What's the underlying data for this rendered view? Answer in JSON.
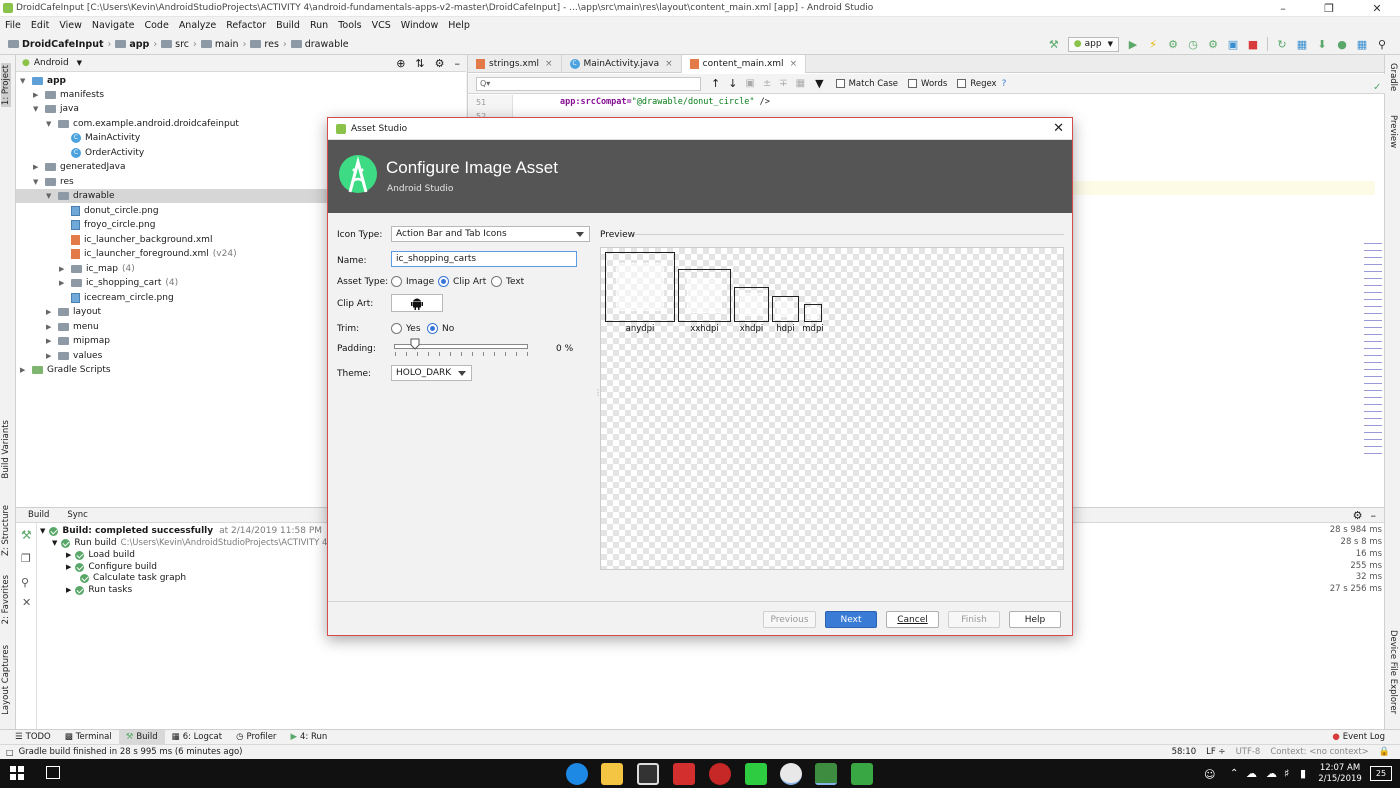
{
  "window": {
    "title": "DroidCafeInput [C:\\Users\\Kevin\\AndroidStudioProjects\\ACTIVITY 4\\android-fundamentals-apps-v2-master\\DroidCafeInput] - ...\\app\\src\\main\\res\\layout\\content_main.xml [app] - Android Studio"
  },
  "menu": [
    "File",
    "Edit",
    "View",
    "Navigate",
    "Code",
    "Analyze",
    "Refactor",
    "Build",
    "Run",
    "Tools",
    "VCS",
    "Window",
    "Help"
  ],
  "breadcrumbs": [
    "DroidCafeInput",
    "app",
    "src",
    "main",
    "res",
    "drawable"
  ],
  "toolbar": {
    "run_config": "app"
  },
  "project": {
    "view_mode": "Android",
    "tree": {
      "app": "app",
      "manifests": "manifests",
      "java": "java",
      "package": "com.example.android.droidcafeinput",
      "main_activity": "MainActivity",
      "order_activity": "OrderActivity",
      "generated_java": "generatedJava",
      "res": "res",
      "drawable": "drawable",
      "donut": "donut_circle.png",
      "froyo": "froyo_circle.png",
      "ic_bg": "ic_launcher_background.xml",
      "ic_fg": "ic_launcher_foreground.xml",
      "ic_fg_sub": "(v24)",
      "ic_map": "ic_map",
      "ic_map_sub": "(4)",
      "ic_cart": "ic_shopping_cart",
      "ic_cart_sub": "(4)",
      "icecream": "icecream_circle.png",
      "layout": "layout",
      "menu": "menu",
      "mipmap": "mipmap",
      "values": "values",
      "gradle": "Gradle Scripts"
    }
  },
  "editor": {
    "tabs": [
      "strings.xml",
      "MainActivity.java",
      "content_main.xml"
    ],
    "search_placeholder": "Q▾",
    "find_options": [
      "Match Case",
      "Words",
      "Regex"
    ],
    "line_51": "51",
    "line_52": "52",
    "code_attr": "app:srcCompat=",
    "code_value": "\"@drawable/donut_circle\"",
    "code_end": " />"
  },
  "left_stripe": [
    "1: Project",
    "Build Variants",
    "Z: Structure",
    "2: Favorites",
    "Layout Captures"
  ],
  "right_stripe": [
    "Gradle",
    "Preview",
    "Device File Explorer"
  ],
  "build": {
    "tabs": [
      "Build",
      "Sync"
    ],
    "root": "Build: completed successfully",
    "root_time": "at 2/14/2019 11:58 PM",
    "run_build": "Run build",
    "run_build_path": "C:\\Users\\Kevin\\AndroidStudioProjects\\ACTIVITY 4\\an",
    "items": [
      "Load build",
      "Configure build",
      "Calculate task graph",
      "Run tasks"
    ],
    "times": [
      "28 s 984 ms",
      "28 s 8 ms",
      "16 ms",
      "255 ms",
      "32 ms",
      "27 s 256 ms"
    ]
  },
  "bottom_tabs": [
    "TODO",
    "Terminal",
    "Build",
    "6: Logcat",
    "Profiler",
    "4: Run"
  ],
  "event_log": "Event Log",
  "status": {
    "message": "Gradle build finished in 28 s 995 ms (6 minutes ago)",
    "position": "58:10",
    "line_sep": "LF ÷",
    "encoding": "UTF-8",
    "context": "Context: <no context>"
  },
  "taskbar": {
    "time": "12:07 AM",
    "date": "2/15/2019",
    "notif": "25"
  },
  "dialog": {
    "window_title": "Asset Studio",
    "heading": "Configure Image Asset",
    "subheading": "Android Studio",
    "icon_type_label": "Icon Type:",
    "icon_type_value": "Action Bar and Tab Icons",
    "name_label": "Name:",
    "name_value": "ic_shopping_carts",
    "asset_type_label": "Asset Type:",
    "asset_type_options": [
      "Image",
      "Clip Art",
      "Text"
    ],
    "asset_type_selected": "Clip Art",
    "clip_art_label": "Clip Art:",
    "trim_label": "Trim:",
    "trim_options": [
      "Yes",
      "No"
    ],
    "trim_selected": "No",
    "padding_label": "Padding:",
    "padding_value": "0 %",
    "padding_level": 0,
    "theme_label": "Theme:",
    "theme_value": "HOLO_DARK",
    "preview_label": "Preview",
    "densities": [
      "anydpi",
      "xxhdpi",
      "xhdpi",
      "hdpi",
      "mdpi"
    ],
    "buttons": {
      "previous": "Previous",
      "next": "Next",
      "cancel": "Cancel",
      "finish": "Finish",
      "help": "Help"
    }
  },
  "colors": {
    "accent": "#3a7bd5",
    "dialog_border": "#d64c4c",
    "header_bg": "#555555",
    "success": "#59a869"
  }
}
